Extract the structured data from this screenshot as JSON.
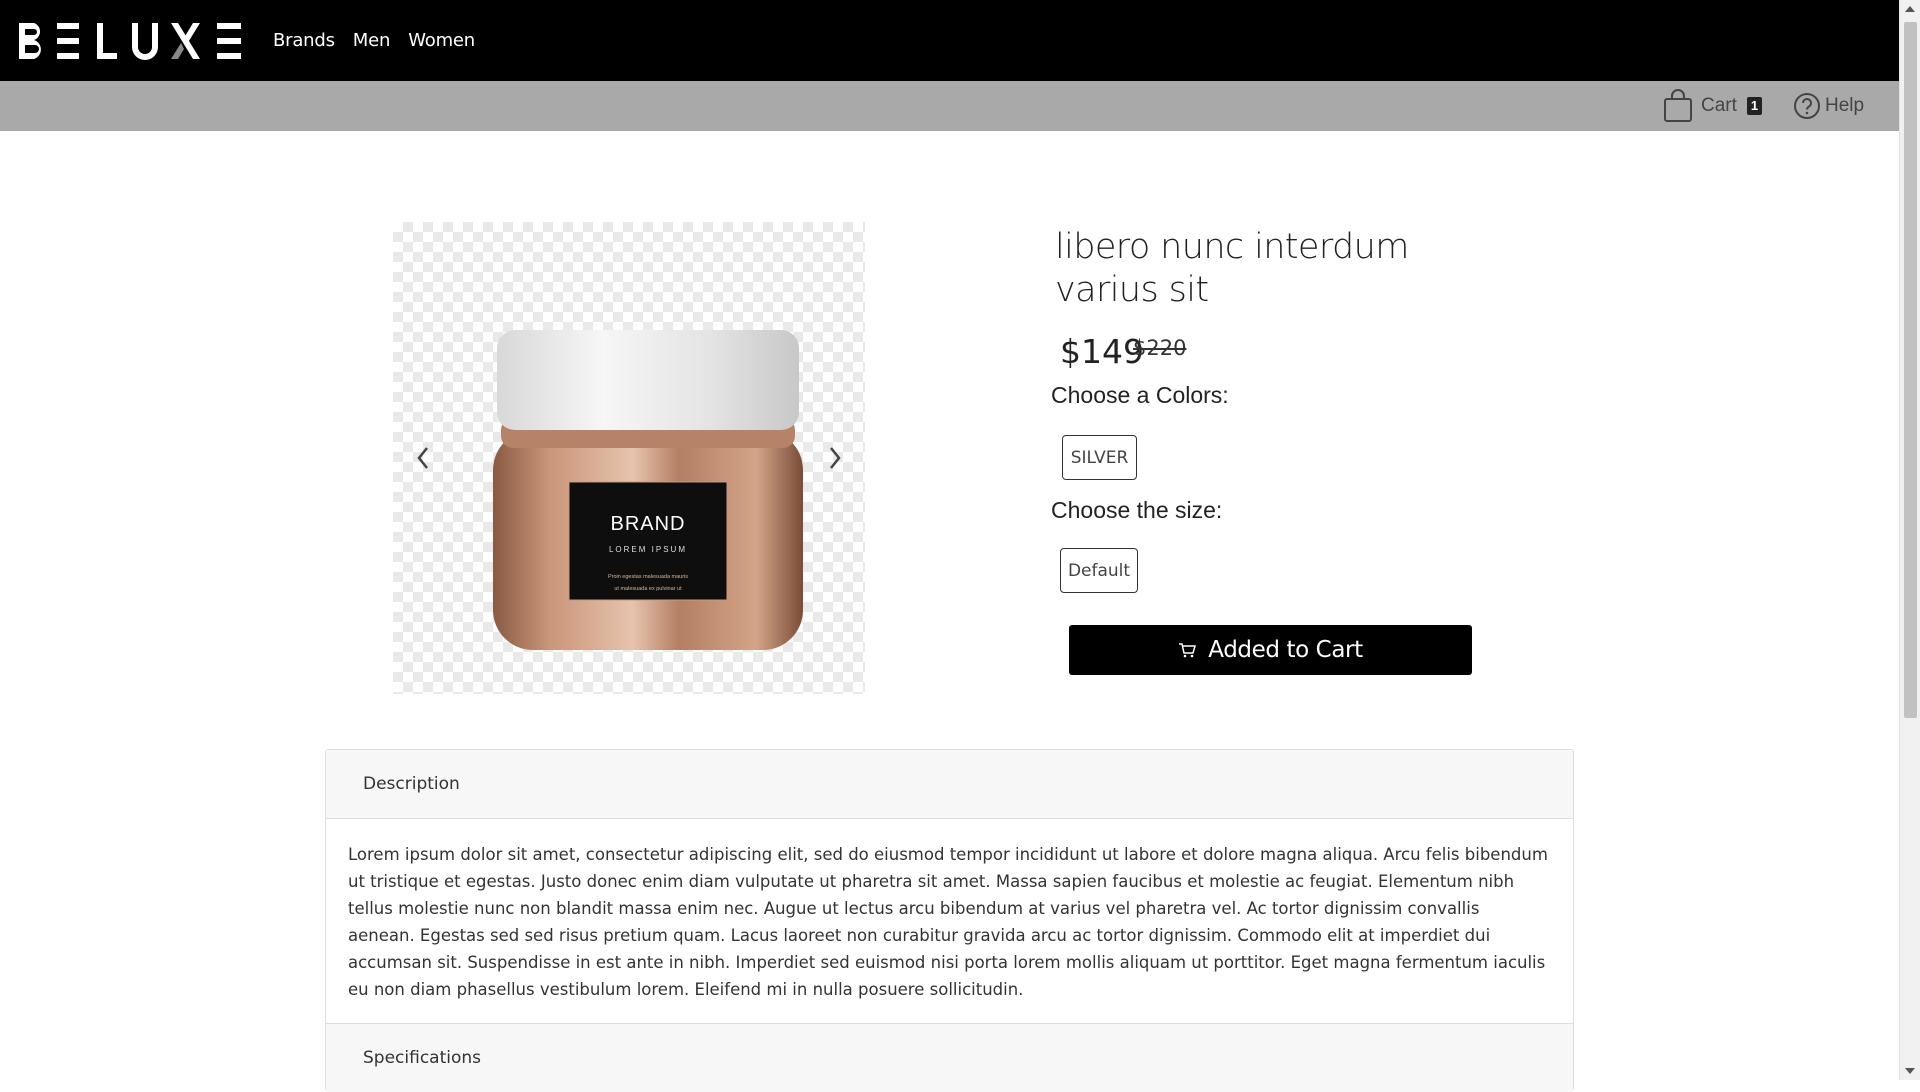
{
  "brand": {
    "logo_text": "BELUXE"
  },
  "nav": {
    "links": [
      {
        "label": "Brands"
      },
      {
        "label": "Men"
      },
      {
        "label": "Women"
      }
    ]
  },
  "subbar": {
    "cart_label": "Cart",
    "cart_count": "1",
    "help_label": "Help"
  },
  "product": {
    "title": "libero nunc interdum varius sit",
    "price": "$149",
    "old_price": "$220",
    "colors_label": "Choose a Colors:",
    "color_option": "SILVER",
    "size_label": "Choose the size:",
    "size_option": "Default",
    "cart_button_label": "Added to Cart",
    "image_label": {
      "brand": "BRAND",
      "sub": "LOREM IPSUM",
      "line1": "Proin egestas malesuada mauris",
      "line2": "ut malesuada ex pulvinar ut"
    }
  },
  "details": {
    "description_heading": "Description",
    "description_text": "Lorem ipsum dolor sit amet, consectetur adipiscing elit, sed do eiusmod tempor incididunt ut labore et dolore magna aliqua. Arcu felis bibendum ut tristique et egestas. Justo donec enim diam vulputate ut pharetra sit amet. Massa sapien faucibus et molestie ac feugiat. Elementum nibh tellus molestie nunc non blandit massa enim nec. Augue ut lectus arcu bibendum at varius vel pharetra vel. Ac tortor dignissim convallis aenean. Egestas sed sed risus pretium quam. Lacus laoreet non curabitur gravida arcu ac tortor dignissim. Commodo elit at imperdiet dui accumsan sit. Suspendisse in est ante in nibh. Imperdiet sed euismod nisi porta lorem mollis aliquam ut porttitor. Eget magna fermentum iaculis eu non diam phasellus vestibulum lorem. Eleifend mi in nulla posuere sollicitudin.",
    "specifications_heading": "Specifications"
  },
  "colors": {
    "nav_bg": "#000000",
    "subbar_bg": "#a9a9a9",
    "button_bg": "#000000"
  }
}
